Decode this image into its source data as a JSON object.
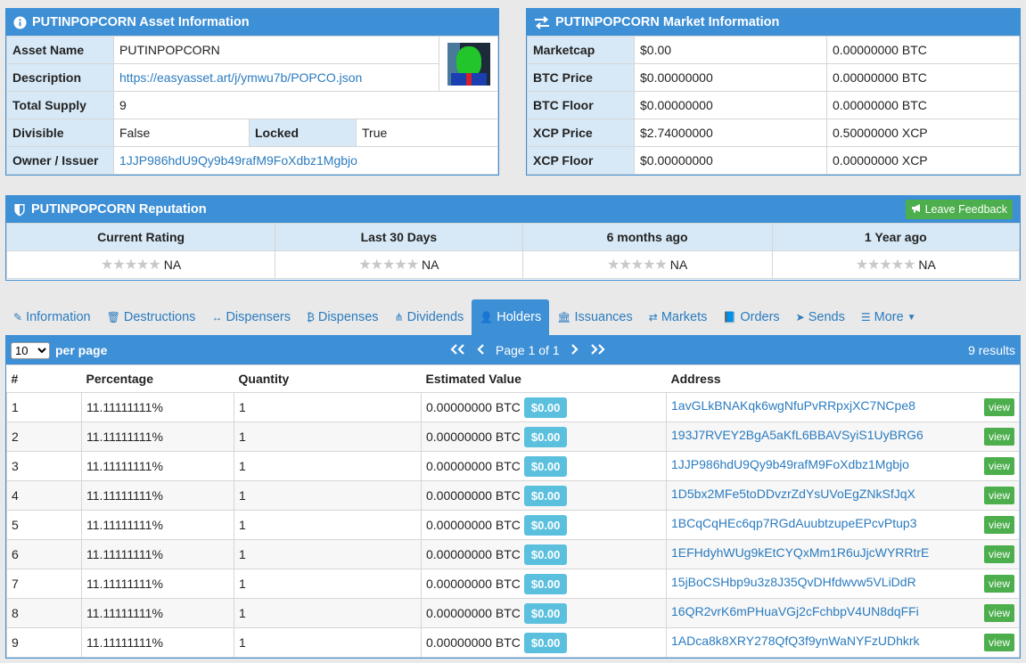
{
  "asset_info": {
    "title": "PUTINPOPCORN Asset Information",
    "rows": {
      "asset_name_label": "Asset Name",
      "asset_name": "PUTINPOPCORN",
      "description_label": "Description",
      "description": "https://easyasset.art/j/ymwu7b/POPCO.json",
      "total_supply_label": "Total Supply",
      "total_supply": "9",
      "divisible_label": "Divisible",
      "divisible": "False",
      "locked_label": "Locked",
      "locked": "True",
      "owner_label": "Owner / Issuer",
      "owner": "1JJP986hdU9Qy9b49rafM9FoXdbz1Mgbjo"
    }
  },
  "market_info": {
    "title": "PUTINPOPCORN Market Information",
    "rows": [
      {
        "label": "Marketcap",
        "usd": "$0.00",
        "crypto": "0.00000000 BTC"
      },
      {
        "label": "BTC Price",
        "usd": "$0.00000000",
        "crypto": "0.00000000 BTC"
      },
      {
        "label": "BTC Floor",
        "usd": "$0.00000000",
        "crypto": "0.00000000 BTC"
      },
      {
        "label": "XCP Price",
        "usd": "$2.74000000",
        "crypto": "0.50000000 XCP"
      },
      {
        "label": "XCP Floor",
        "usd": "$0.00000000",
        "crypto": "0.00000000 XCP"
      }
    ]
  },
  "reputation": {
    "title": "PUTINPOPCORN Reputation",
    "feedback_button": "Leave Feedback",
    "columns": [
      "Current Rating",
      "Last 30 Days",
      "6 months ago",
      "1 Year ago"
    ],
    "values": [
      "NA",
      "NA",
      "NA",
      "NA"
    ],
    "stars": "★★★★★"
  },
  "tabs": [
    {
      "label": "Information",
      "icon": "paperclip-icon",
      "glyph": "✎"
    },
    {
      "label": "Destructions",
      "icon": "trash-icon",
      "glyph": "🗑"
    },
    {
      "label": "Dispensers",
      "icon": "arrows-h-icon",
      "glyph": "↔"
    },
    {
      "label": "Dispenses",
      "icon": "bitcoin-icon",
      "glyph": "₿"
    },
    {
      "label": "Dividends",
      "icon": "sitemap-icon",
      "glyph": "⋔"
    },
    {
      "label": "Holders",
      "icon": "user-icon",
      "glyph": "👤"
    },
    {
      "label": "Issuances",
      "icon": "bank-icon",
      "glyph": "🏛"
    },
    {
      "label": "Markets",
      "icon": "exchange-icon",
      "glyph": "⇄"
    },
    {
      "label": "Orders",
      "icon": "book-icon",
      "glyph": "📘"
    },
    {
      "label": "Sends",
      "icon": "send-icon",
      "glyph": "➤"
    },
    {
      "label": "More",
      "icon": "list-icon",
      "glyph": "☰"
    }
  ],
  "holders": {
    "per_page_value": "10",
    "per_page_label": "per page",
    "first": "<<",
    "prev": "<",
    "page_text": "Page 1 of 1",
    "next": ">",
    "last": ">>",
    "results": "9 results",
    "headers": [
      "#",
      "Percentage",
      "Quantity",
      "Estimated Value",
      "Address"
    ],
    "view_label": "view",
    "rows": [
      {
        "n": "1",
        "pct": "11.11111111%",
        "qty": "1",
        "btc": "0.00000000 BTC",
        "usd": "$0.00",
        "addr": "1avGLkBNAKqk6wgNfuPvRRpxjXC7NCpe8"
      },
      {
        "n": "2",
        "pct": "11.11111111%",
        "qty": "1",
        "btc": "0.00000000 BTC",
        "usd": "$0.00",
        "addr": "193J7RVEY2BgA5aKfL6BBAVSyiS1UyBRG6"
      },
      {
        "n": "3",
        "pct": "11.11111111%",
        "qty": "1",
        "btc": "0.00000000 BTC",
        "usd": "$0.00",
        "addr": "1JJP986hdU9Qy9b49rafM9FoXdbz1Mgbjo"
      },
      {
        "n": "4",
        "pct": "11.11111111%",
        "qty": "1",
        "btc": "0.00000000 BTC",
        "usd": "$0.00",
        "addr": "1D5bx2MFe5toDDvzrZdYsUVoEgZNkSfJqX"
      },
      {
        "n": "5",
        "pct": "11.11111111%",
        "qty": "1",
        "btc": "0.00000000 BTC",
        "usd": "$0.00",
        "addr": "1BCqCqHEc6qp7RGdAuubtzupeEPcvPtup3"
      },
      {
        "n": "6",
        "pct": "11.11111111%",
        "qty": "1",
        "btc": "0.00000000 BTC",
        "usd": "$0.00",
        "addr": "1EFHdyhWUg9kEtCYQxMm1R6uJjcWYRRtrE"
      },
      {
        "n": "7",
        "pct": "11.11111111%",
        "qty": "1",
        "btc": "0.00000000 BTC",
        "usd": "$0.00",
        "addr": "15jBoCSHbp9u3z8J35QvDHfdwvw5VLiDdR"
      },
      {
        "n": "8",
        "pct": "11.11111111%",
        "qty": "1",
        "btc": "0.00000000 BTC",
        "usd": "$0.00",
        "addr": "16QR2vrK6mPHuaVGj2cFchbpV4UN8dqFFi"
      },
      {
        "n": "9",
        "pct": "11.11111111%",
        "qty": "1",
        "btc": "0.00000000 BTC",
        "usd": "$0.00",
        "addr": "1ADca8k8XRY278QfQ3f9ynWaNYFzUDhkrk"
      }
    ]
  },
  "colors": {
    "primary": "#3d8fd6",
    "label_bg": "#d7e9f7",
    "link": "#2a7bbf",
    "success": "#4cae4c",
    "info": "#5bc0de"
  }
}
